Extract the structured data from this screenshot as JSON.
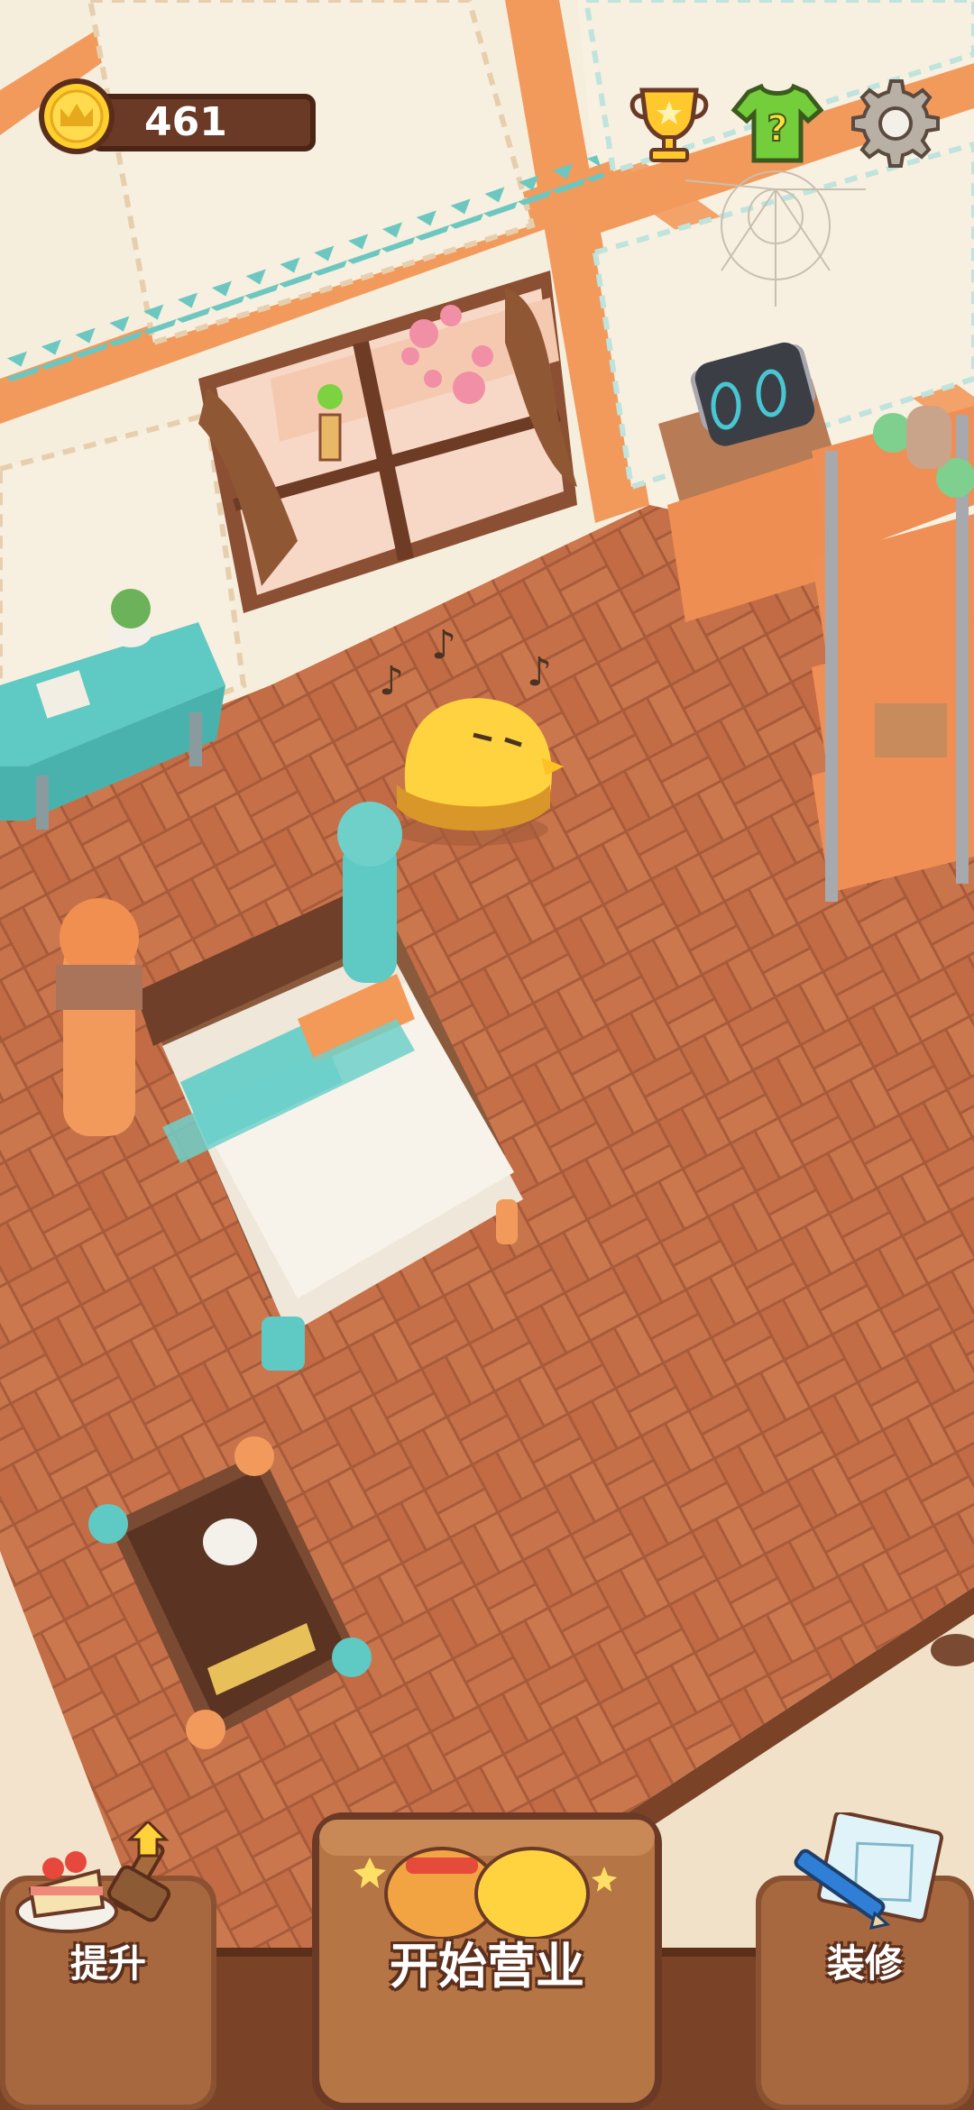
{
  "hud": {
    "coins": "461"
  },
  "buttons": {
    "upgrade_label": "提升",
    "start_business_label": "开始营业",
    "decorate_label": "装修"
  },
  "icons": {
    "coin": "coin-crown-icon",
    "trophy": "trophy-icon",
    "wardrobe": "shirt-question-icon",
    "settings": "gear-icon",
    "upgrade": "cake-hammer-icon",
    "start": "chicks-icon",
    "decorate": "blueprint-pencil-icon"
  },
  "colors": {
    "wall": "#f6eedd",
    "wall_trim": "#f29a5c",
    "floor": "#c7714a",
    "floor_dark": "#a85a38",
    "turquoise": "#5fc9c3",
    "hud_dark": "#6b3a26",
    "button_wood": "#8b5232"
  }
}
